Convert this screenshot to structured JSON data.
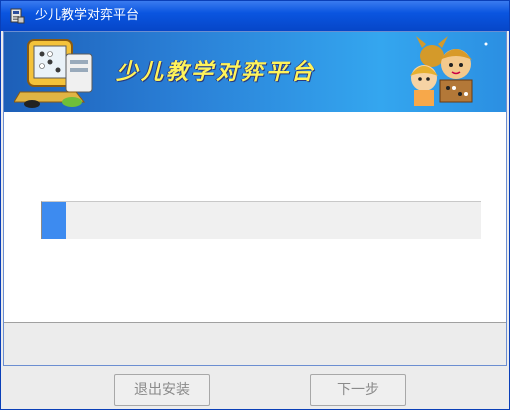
{
  "window": {
    "title": "少儿教学对弈平台"
  },
  "banner": {
    "title": "少儿教学对弈平台"
  },
  "progress": {
    "fraction": 0.055,
    "color": "#3d8bf0"
  },
  "buttons": {
    "exit_label": "退出安装",
    "next_label": "下一步"
  }
}
